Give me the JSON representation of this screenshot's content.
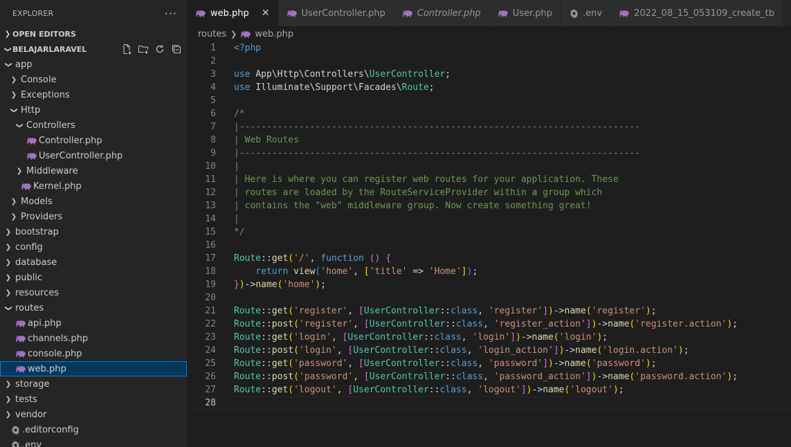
{
  "sidebar": {
    "title": "EXPLORER",
    "more_label": "···",
    "open_editors_label": "OPEN EDITORS",
    "project_label": "BELAJARLARAVEL",
    "tree": [
      {
        "label": "app",
        "depth": 0,
        "kind": "folder",
        "open": true
      },
      {
        "label": "Console",
        "depth": 1,
        "kind": "folder",
        "open": false
      },
      {
        "label": "Exceptions",
        "depth": 1,
        "kind": "folder",
        "open": false
      },
      {
        "label": "Http",
        "depth": 1,
        "kind": "folder",
        "open": true
      },
      {
        "label": "Controllers",
        "depth": 2,
        "kind": "folder",
        "open": true
      },
      {
        "label": "Controller.php",
        "depth": 3,
        "kind": "php"
      },
      {
        "label": "UserController.php",
        "depth": 3,
        "kind": "php"
      },
      {
        "label": "Middleware",
        "depth": 2,
        "kind": "folder",
        "open": false
      },
      {
        "label": "Kernel.php",
        "depth": 2,
        "kind": "php"
      },
      {
        "label": "Models",
        "depth": 1,
        "kind": "folder",
        "open": false
      },
      {
        "label": "Providers",
        "depth": 1,
        "kind": "folder",
        "open": false
      },
      {
        "label": "bootstrap",
        "depth": 0,
        "kind": "folder",
        "open": false
      },
      {
        "label": "config",
        "depth": 0,
        "kind": "folder",
        "open": false
      },
      {
        "label": "database",
        "depth": 0,
        "kind": "folder",
        "open": false
      },
      {
        "label": "public",
        "depth": 0,
        "kind": "folder",
        "open": false
      },
      {
        "label": "resources",
        "depth": 0,
        "kind": "folder",
        "open": false
      },
      {
        "label": "routes",
        "depth": 0,
        "kind": "folder",
        "open": true
      },
      {
        "label": "api.php",
        "depth": 1,
        "kind": "php"
      },
      {
        "label": "channels.php",
        "depth": 1,
        "kind": "php"
      },
      {
        "label": "console.php",
        "depth": 1,
        "kind": "php"
      },
      {
        "label": "web.php",
        "depth": 1,
        "kind": "php",
        "selected": true
      },
      {
        "label": "storage",
        "depth": 0,
        "kind": "folder",
        "open": false
      },
      {
        "label": "tests",
        "depth": 0,
        "kind": "folder",
        "open": false
      },
      {
        "label": "vendor",
        "depth": 0,
        "kind": "folder",
        "open": false
      },
      {
        "label": ".editorconfig",
        "depth": 0,
        "kind": "config"
      },
      {
        "label": ".env",
        "depth": 0,
        "kind": "config"
      }
    ]
  },
  "tabs": [
    {
      "label": "web.php",
      "icon": "php-elephant-icon",
      "active": true,
      "italic": false
    },
    {
      "label": "UserController.php",
      "icon": "php-elephant-icon",
      "active": false,
      "italic": false
    },
    {
      "label": "Controller.php",
      "icon": "php-elephant-icon",
      "active": false,
      "italic": true
    },
    {
      "label": "User.php",
      "icon": "php-elephant-icon",
      "active": false,
      "italic": false
    },
    {
      "label": ".env",
      "icon": "gear-icon",
      "active": false,
      "italic": false
    },
    {
      "label": "2022_08_15_053109_create_tb",
      "icon": "php-elephant-icon",
      "active": false,
      "italic": false
    }
  ],
  "breadcrumb": {
    "folder": "routes",
    "file": "web.php"
  },
  "editor": {
    "current_line": 28,
    "lines": [
      [
        [
          "<?php",
          "kw"
        ]
      ],
      [],
      [
        [
          "use ",
          "kw"
        ],
        [
          "App\\Http\\Controllers\\",
          "def"
        ],
        [
          "UserController",
          "cls"
        ],
        [
          ";",
          "def"
        ]
      ],
      [
        [
          "use ",
          "kw"
        ],
        [
          "Illuminate\\Support\\Facades\\",
          "def"
        ],
        [
          "Route",
          "cls"
        ],
        [
          ";",
          "def"
        ]
      ],
      [],
      [
        [
          "/*",
          "cmt"
        ]
      ],
      [
        [
          "|--------------------------------------------------------------------------",
          "cmt"
        ]
      ],
      [
        [
          "| Web Routes",
          "cmt"
        ]
      ],
      [
        [
          "|--------------------------------------------------------------------------",
          "cmt"
        ]
      ],
      [
        [
          "|",
          "cmt"
        ]
      ],
      [
        [
          "| Here is where you can register web routes for your application. These",
          "cmt"
        ]
      ],
      [
        [
          "| routes are loaded by the RouteServiceProvider within a group which",
          "cmt"
        ]
      ],
      [
        [
          "| contains the \"web\" middleware group. Now create something great!",
          "cmt"
        ]
      ],
      [
        [
          "|",
          "cmt"
        ]
      ],
      [
        [
          "*/",
          "cmt"
        ]
      ],
      [],
      [
        [
          "Route",
          "cls"
        ],
        [
          "::",
          "def"
        ],
        [
          "get",
          "fn"
        ],
        [
          "(",
          "b1"
        ],
        [
          "'/'",
          "str"
        ],
        [
          ", ",
          "def"
        ],
        [
          "function",
          "kw"
        ],
        [
          " ",
          "def"
        ],
        [
          "()",
          "b2"
        ],
        [
          " ",
          "def"
        ],
        [
          "{",
          "b2"
        ]
      ],
      [
        [
          "    ",
          "def"
        ],
        [
          "return ",
          "kw"
        ],
        [
          "view",
          "fn"
        ],
        [
          "(",
          "b3"
        ],
        [
          "'home'",
          "str"
        ],
        [
          ", ",
          "def"
        ],
        [
          "[",
          "b1"
        ],
        [
          "'title'",
          "str"
        ],
        [
          " => ",
          "def"
        ],
        [
          "'Home'",
          "str"
        ],
        [
          "]",
          "b1"
        ],
        [
          ")",
          "b3"
        ],
        [
          ";",
          "def"
        ]
      ],
      [
        [
          "}",
          "b2"
        ],
        [
          ")",
          "b1"
        ],
        [
          "->",
          "def"
        ],
        [
          "name",
          "fn"
        ],
        [
          "(",
          "b1"
        ],
        [
          "'home'",
          "str"
        ],
        [
          ")",
          "b1"
        ],
        [
          ";",
          "def"
        ]
      ],
      [],
      [
        [
          "Route",
          "cls"
        ],
        [
          "::",
          "def"
        ],
        [
          "get",
          "fn"
        ],
        [
          "(",
          "b1"
        ],
        [
          "'register'",
          "str"
        ],
        [
          ", ",
          "def"
        ],
        [
          "[",
          "b2"
        ],
        [
          "UserController",
          "cls"
        ],
        [
          "::",
          "def"
        ],
        [
          "class",
          "kw"
        ],
        [
          ", ",
          "def"
        ],
        [
          "'register'",
          "str"
        ],
        [
          "]",
          "b2"
        ],
        [
          ")",
          "b1"
        ],
        [
          "->",
          "def"
        ],
        [
          "name",
          "fn"
        ],
        [
          "(",
          "b1"
        ],
        [
          "'register'",
          "str"
        ],
        [
          ")",
          "b1"
        ],
        [
          ";",
          "def"
        ]
      ],
      [
        [
          "Route",
          "cls"
        ],
        [
          "::",
          "def"
        ],
        [
          "post",
          "fn"
        ],
        [
          "(",
          "b1"
        ],
        [
          "'register'",
          "str"
        ],
        [
          ", ",
          "def"
        ],
        [
          "[",
          "b2"
        ],
        [
          "UserController",
          "cls"
        ],
        [
          "::",
          "def"
        ],
        [
          "class",
          "kw"
        ],
        [
          ", ",
          "def"
        ],
        [
          "'register_action'",
          "str"
        ],
        [
          "]",
          "b2"
        ],
        [
          ")",
          "b1"
        ],
        [
          "->",
          "def"
        ],
        [
          "name",
          "fn"
        ],
        [
          "(",
          "b1"
        ],
        [
          "'register.action'",
          "str"
        ],
        [
          ")",
          "b1"
        ],
        [
          ";",
          "def"
        ]
      ],
      [
        [
          "Route",
          "cls"
        ],
        [
          "::",
          "def"
        ],
        [
          "get",
          "fn"
        ],
        [
          "(",
          "b1"
        ],
        [
          "'login'",
          "str"
        ],
        [
          ", ",
          "def"
        ],
        [
          "[",
          "b2"
        ],
        [
          "UserController",
          "cls"
        ],
        [
          "::",
          "def"
        ],
        [
          "class",
          "kw"
        ],
        [
          ", ",
          "def"
        ],
        [
          "'login'",
          "str"
        ],
        [
          "]",
          "b2"
        ],
        [
          ")",
          "b1"
        ],
        [
          "->",
          "def"
        ],
        [
          "name",
          "fn"
        ],
        [
          "(",
          "b1"
        ],
        [
          "'login'",
          "str"
        ],
        [
          ")",
          "b1"
        ],
        [
          ";",
          "def"
        ]
      ],
      [
        [
          "Route",
          "cls"
        ],
        [
          "::",
          "def"
        ],
        [
          "post",
          "fn"
        ],
        [
          "(",
          "b1"
        ],
        [
          "'login'",
          "str"
        ],
        [
          ", ",
          "def"
        ],
        [
          "[",
          "b2"
        ],
        [
          "UserController",
          "cls"
        ],
        [
          "::",
          "def"
        ],
        [
          "class",
          "kw"
        ],
        [
          ", ",
          "def"
        ],
        [
          "'login_action'",
          "str"
        ],
        [
          "]",
          "b2"
        ],
        [
          ")",
          "b1"
        ],
        [
          "->",
          "def"
        ],
        [
          "name",
          "fn"
        ],
        [
          "(",
          "b1"
        ],
        [
          "'login.action'",
          "str"
        ],
        [
          ")",
          "b1"
        ],
        [
          ";",
          "def"
        ]
      ],
      [
        [
          "Route",
          "cls"
        ],
        [
          "::",
          "def"
        ],
        [
          "get",
          "fn"
        ],
        [
          "(",
          "b1"
        ],
        [
          "'password'",
          "str"
        ],
        [
          ", ",
          "def"
        ],
        [
          "[",
          "b2"
        ],
        [
          "UserController",
          "cls"
        ],
        [
          "::",
          "def"
        ],
        [
          "class",
          "kw"
        ],
        [
          ", ",
          "def"
        ],
        [
          "'password'",
          "str"
        ],
        [
          "]",
          "b2"
        ],
        [
          ")",
          "b1"
        ],
        [
          "->",
          "def"
        ],
        [
          "name",
          "fn"
        ],
        [
          "(",
          "b1"
        ],
        [
          "'password'",
          "str"
        ],
        [
          ")",
          "b1"
        ],
        [
          ";",
          "def"
        ]
      ],
      [
        [
          "Route",
          "cls"
        ],
        [
          "::",
          "def"
        ],
        [
          "post",
          "fn"
        ],
        [
          "(",
          "b1"
        ],
        [
          "'password'",
          "str"
        ],
        [
          ", ",
          "def"
        ],
        [
          "[",
          "b2"
        ],
        [
          "UserController",
          "cls"
        ],
        [
          "::",
          "def"
        ],
        [
          "class",
          "kw"
        ],
        [
          ", ",
          "def"
        ],
        [
          "'password_action'",
          "str"
        ],
        [
          "]",
          "b2"
        ],
        [
          ")",
          "b1"
        ],
        [
          "->",
          "def"
        ],
        [
          "name",
          "fn"
        ],
        [
          "(",
          "b1"
        ],
        [
          "'password.action'",
          "str"
        ],
        [
          ")",
          "b1"
        ],
        [
          ";",
          "def"
        ]
      ],
      [
        [
          "Route",
          "cls"
        ],
        [
          "::",
          "def"
        ],
        [
          "get",
          "fn"
        ],
        [
          "(",
          "b1"
        ],
        [
          "'logout'",
          "str"
        ],
        [
          ", ",
          "def"
        ],
        [
          "[",
          "b2"
        ],
        [
          "UserController",
          "cls"
        ],
        [
          "::",
          "def"
        ],
        [
          "class",
          "kw"
        ],
        [
          ", ",
          "def"
        ],
        [
          "'logout'",
          "str"
        ],
        [
          "]",
          "b2"
        ],
        [
          ")",
          "b1"
        ],
        [
          "->",
          "def"
        ],
        [
          "name",
          "fn"
        ],
        [
          "(",
          "b1"
        ],
        [
          "'logout'",
          "str"
        ],
        [
          ")",
          "b1"
        ],
        [
          ";",
          "def"
        ]
      ],
      []
    ]
  }
}
